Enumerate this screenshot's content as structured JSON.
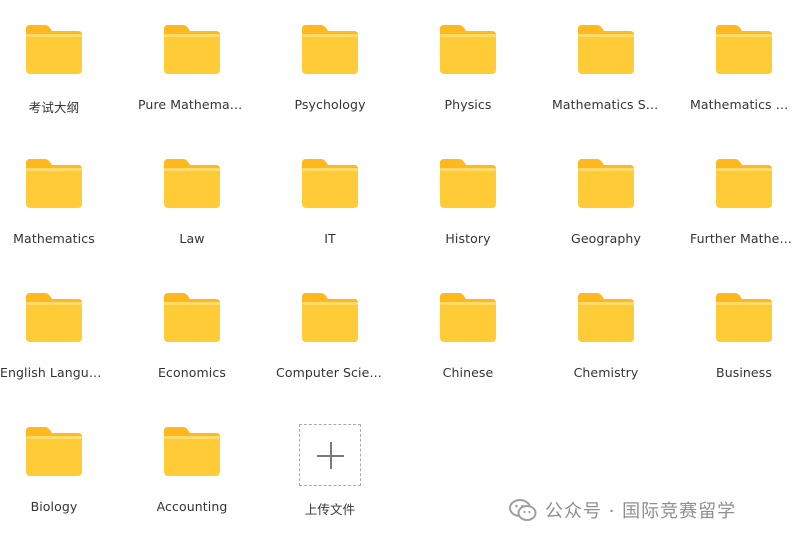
{
  "folders": [
    {
      "label": "考试大纲"
    },
    {
      "label": "Pure Mathematics"
    },
    {
      "label": "Psychology"
    },
    {
      "label": "Physics"
    },
    {
      "label": "Mathematics Statistics"
    },
    {
      "label": "Mathematics Mechanics"
    },
    {
      "label": "Mathematics"
    },
    {
      "label": "Law"
    },
    {
      "label": "IT"
    },
    {
      "label": "History"
    },
    {
      "label": "Geography"
    },
    {
      "label": "Further Mathematics"
    },
    {
      "label": "English Language"
    },
    {
      "label": "Economics"
    },
    {
      "label": "Computer Science"
    },
    {
      "label": "Chinese"
    },
    {
      "label": "Chemistry"
    },
    {
      "label": "Business"
    },
    {
      "label": "Biology"
    },
    {
      "label": "Accounting"
    }
  ],
  "upload": {
    "label": "上传文件",
    "icon": "plus-icon"
  },
  "watermark": {
    "text": "公众号 · 国际竞赛留学",
    "icon": "wechat-icon"
  },
  "colors": {
    "folder_front": "#FFCB36",
    "folder_back": "#FFB81E",
    "folder_highlight": "#FFDC6A",
    "label_text": "#333333",
    "watermark": "#8f8f8f"
  }
}
